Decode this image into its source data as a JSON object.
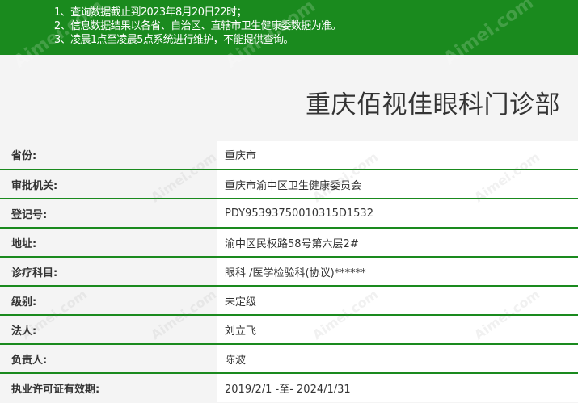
{
  "notice": {
    "lines": [
      "1、查询数据截止到2023年8月20日22时；",
      "2、信息数据结果以各省、自治区、直辖市卫生健康委数据为准。",
      "3、凌晨1点至凌晨5点系统进行维护，不能提供查询。"
    ]
  },
  "clinic": {
    "name": "重庆佰视佳眼科门诊部"
  },
  "details": [
    {
      "label": "省份:",
      "value": "重庆市"
    },
    {
      "label": "审批机关:",
      "value": "重庆市渝中区卫生健康委员会"
    },
    {
      "label": "登记号:",
      "value": "PDY95393750010315D1532"
    },
    {
      "label": "地址:",
      "value": "渝中区民权路58号第六层2#"
    },
    {
      "label": "诊疗科目:",
      "value": "眼科 /医学检验科(协议)******"
    },
    {
      "label": "级别:",
      "value": "未定级"
    },
    {
      "label": "法人:",
      "value": "刘立飞"
    },
    {
      "label": "负责人:",
      "value": "陈波"
    },
    {
      "label": "执业许可证有效期:",
      "value": "2019/2/1 -至- 2024/1/31"
    }
  ],
  "watermark": {
    "text": "Aimei.com"
  },
  "colors": {
    "banner_green": "#1a8a1e",
    "row_divider": "#1a8a1e",
    "label_bg": "#f4f4f4",
    "value_bg": "#ffffff",
    "text": "#333333"
  }
}
